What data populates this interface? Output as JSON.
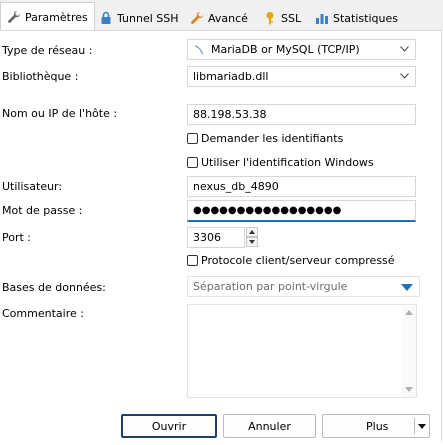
{
  "tabs": [
    {
      "label": "Paramètres",
      "icon": "wrench-icon",
      "active": true
    },
    {
      "label": "Tunnel SSH",
      "icon": "lock-icon"
    },
    {
      "label": "Avancé",
      "icon": "wrench-icon"
    },
    {
      "label": "SSL",
      "icon": "key-icon"
    },
    {
      "label": "Statistiques",
      "icon": "bar-chart-icon"
    }
  ],
  "form": {
    "network_type_label": "Type de réseau :",
    "network_type_value": "MariaDB or MySQL (TCP/IP)",
    "library_label": "Bibliothèque :",
    "library_value": "libmariadb.dll",
    "host_label": "Nom ou IP de l'hôte :",
    "host_value": "88.198.53.38",
    "ask_credentials_label": "Demander les identifiants",
    "windows_auth_label": "Utiliser l'identification Windows",
    "user_label": "Utilisateur:",
    "user_value": "nexus_db_4890",
    "password_label": "Mot de passe :",
    "password_value": "●●●●●●●●●●●●●●●●●",
    "port_label": "Port :",
    "port_value": "3306",
    "compressed_label": "Protocole client/serveur compressé",
    "databases_label": "Bases de données:",
    "databases_placeholder": "Séparation par point-virgule",
    "comment_label": "Commentaire :",
    "comment_value": ""
  },
  "buttons": {
    "open": "Ouvrir",
    "cancel": "Annuler",
    "more": "Plus"
  },
  "colors": {
    "accent": "#1f6fbf",
    "tab_bg": "#f0f0f0"
  }
}
